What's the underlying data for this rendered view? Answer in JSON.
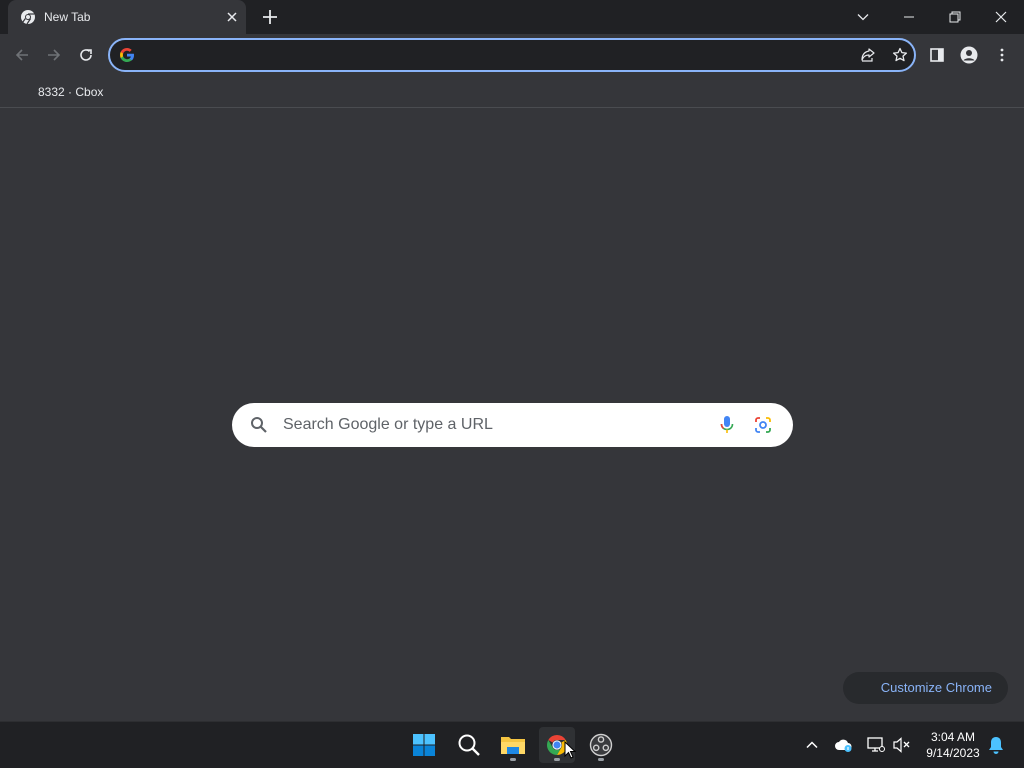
{
  "tab": {
    "title": "New Tab",
    "favicon": "chrome-icon"
  },
  "omnibox": {
    "value": "",
    "placeholder": ""
  },
  "bookmarks": [
    {
      "label": "8332 · Cbox"
    }
  ],
  "ntp": {
    "search_placeholder": "Search Google or type a URL",
    "customize_label": "Customize Chrome"
  },
  "taskbar": {
    "apps": [
      "start-icon",
      "search-icon",
      "file-explorer-icon",
      "chrome-icon",
      "obs-icon"
    ],
    "time": "3:04 AM",
    "date": "9/14/2023"
  },
  "colors": {
    "accent": "#8ab4f8",
    "frame": "#202124",
    "toolbar": "#35363a"
  }
}
